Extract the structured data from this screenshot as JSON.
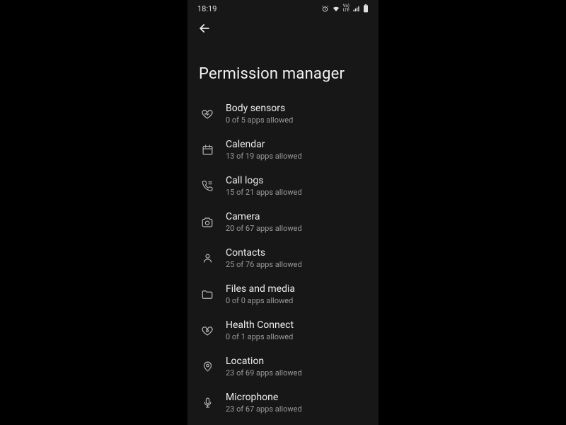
{
  "statusbar": {
    "time": "18:19"
  },
  "page": {
    "title": "Permission manager"
  },
  "permissions": [
    {
      "icon": "heart-monitor",
      "label": "Body sensors",
      "sub": "0 of 5 apps allowed"
    },
    {
      "icon": "calendar",
      "label": "Calendar",
      "sub": "13 of 19 apps allowed"
    },
    {
      "icon": "call-log",
      "label": "Call logs",
      "sub": "15 of 21 apps allowed"
    },
    {
      "icon": "camera",
      "label": "Camera",
      "sub": "20 of 67 apps allowed"
    },
    {
      "icon": "contacts",
      "label": "Contacts",
      "sub": "25 of 76 apps allowed"
    },
    {
      "icon": "folder",
      "label": "Files and media",
      "sub": "0 of 0 apps allowed"
    },
    {
      "icon": "health",
      "label": "Health Connect",
      "sub": "0 of 1 apps allowed"
    },
    {
      "icon": "location",
      "label": "Location",
      "sub": "23 of 69 apps allowed"
    },
    {
      "icon": "microphone",
      "label": "Microphone",
      "sub": "23 of 67 apps allowed"
    }
  ]
}
